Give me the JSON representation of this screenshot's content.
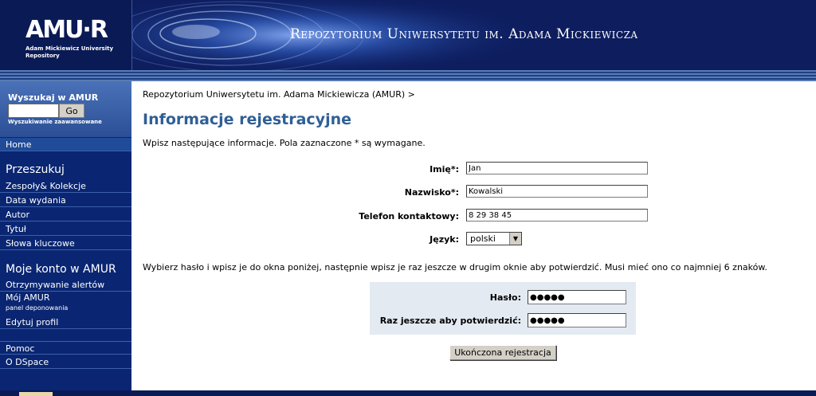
{
  "header": {
    "logo": "AMU·R",
    "logo_sub": "Adam Mickiewicz University Repository",
    "title": "Repozytorium Uniwersytetu im. Adama Mickiewicza"
  },
  "sidebar": {
    "search_label": "Wyszukaj w AMUR",
    "search_value": "",
    "go_label": "Go",
    "advanced_search": "Wyszukiwanie zaawansowane",
    "home": "Home",
    "browse_heading": "Przeszukuj",
    "browse_items": [
      "Zespoły& Kolekcje",
      "Data wydania",
      "Autor",
      "Tytuł",
      "Słowa kluczowe"
    ],
    "account_heading": "Moje konto w AMUR",
    "account_items": [
      "Otrzymywanie alertów",
      "Mój AMUR",
      "Edytuj profil"
    ],
    "my_amur_sub": "panel deponowania",
    "help_items": [
      "Pomoc",
      "O DSpace"
    ]
  },
  "main": {
    "breadcrumb": "Repozytorium Uniwersytetu im. Adama Mickiewicza (AMUR) >",
    "title": "Informacje rejestracyjne",
    "intro": "Wpisz następujące informacje. Pola zaznaczone * są wymagane.",
    "first_name_label": "Imię*:",
    "first_name_value": "Jan",
    "last_name_label": "Nazwisko*:",
    "last_name_value": "Kowalski",
    "phone_label": "Telefon kontaktowy:",
    "phone_value": "8 29 38 45",
    "language_label": "Język:",
    "language_value": "polski",
    "password_note": "Wybierz hasło i wpisz je do okna poniżej, następnie wpisz je raz jeszcze w drugim oknie aby potwierdzić. Musi mieć ono co najmniej 6 znaków.",
    "password_label": "Hasło:",
    "password_value": "●●●●●",
    "confirm_label": "Raz jeszcze aby potwierdzić:",
    "confirm_value": "●●●●●",
    "submit_label": "Ukończona rejestracja"
  }
}
